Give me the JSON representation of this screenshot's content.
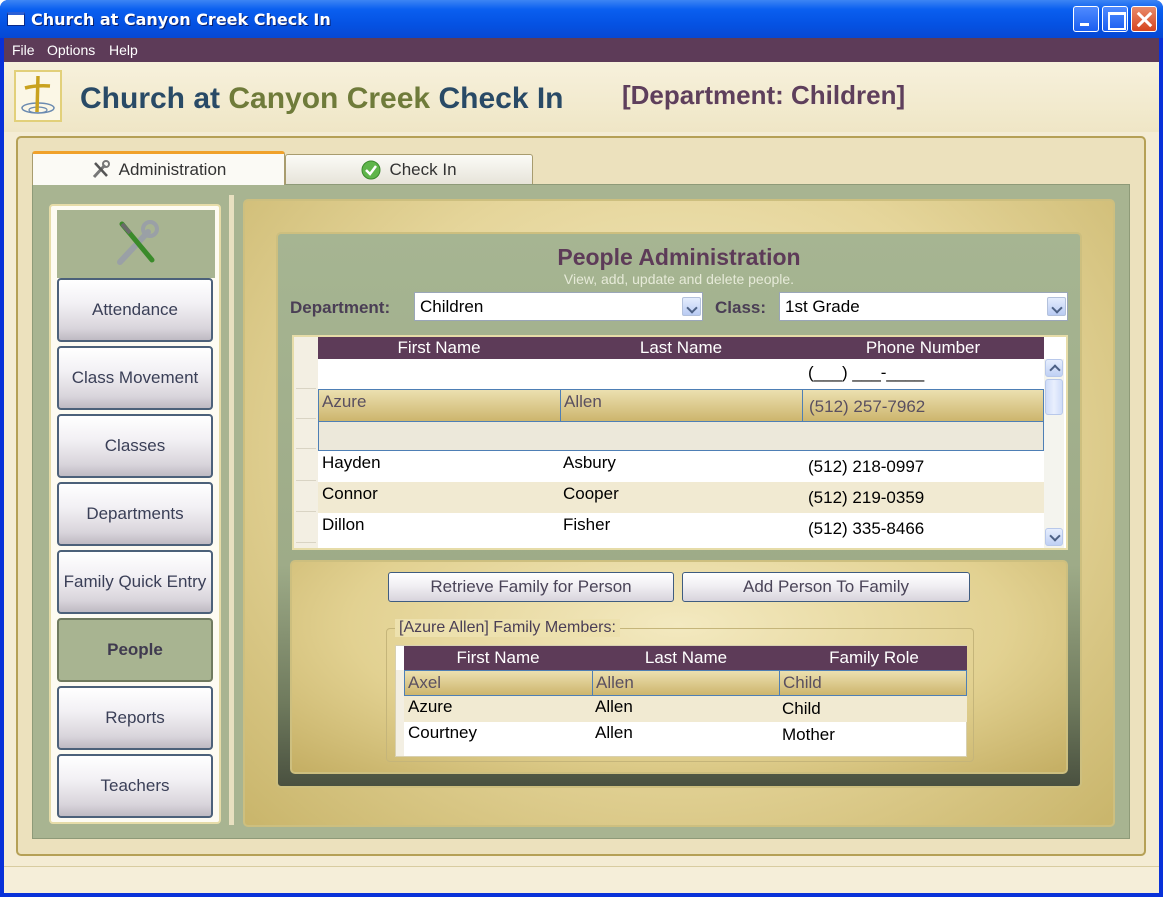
{
  "window": {
    "title": "Church at Canyon Creek Check In"
  },
  "menu": [
    "File",
    "Options",
    "Help"
  ],
  "header": {
    "title_part1": "Church at",
    "title_part2": "Canyon Creek",
    "title_part3": "Check In",
    "department": "[Department: Children]"
  },
  "tabs": [
    {
      "label": "Administration",
      "icon": "tools-icon",
      "active": true
    },
    {
      "label": "Check In",
      "icon": "check-icon",
      "active": false
    }
  ],
  "nav": {
    "items": [
      "Attendance",
      "Class Movement",
      "Classes",
      "Departments",
      "Family Quick Entry",
      "People",
      "Reports",
      "Teachers"
    ],
    "active": "People"
  },
  "people_admin": {
    "title": "People Administration",
    "subtitle": "View, add, update and delete people.",
    "department_label": "Department:",
    "department_value": "Children",
    "class_label": "Class:",
    "class_value": "1st Grade"
  },
  "people_grid": {
    "columns": [
      "First Name",
      "Last Name",
      "Phone Number"
    ],
    "new_row_phone_mask": "(___) ___-____",
    "selected": {
      "first": "Azure",
      "last": "Allen",
      "phone": "(512) 257-7962"
    },
    "rows": [
      {
        "first": "Hayden",
        "last": "Asbury",
        "phone": "(512) 218-0997"
      },
      {
        "first": "Connor",
        "last": "Cooper",
        "phone": "(512) 219-0359"
      },
      {
        "first": "Dillon",
        "last": "Fisher",
        "phone": "(512) 335-8466"
      }
    ]
  },
  "family": {
    "retrieve_button": "Retrieve Family for Person",
    "add_button": "Add Person To Family",
    "group_label": "[Azure Allen] Family Members:",
    "columns": [
      "First Name",
      "Last Name",
      "Family Role"
    ],
    "selected": {
      "first": "Axel",
      "last": "Allen",
      "role": "Child"
    },
    "rows": [
      {
        "first": "Azure",
        "last": "Allen",
        "role": "Child"
      },
      {
        "first": "Courtney",
        "last": "Allen",
        "role": "Mother"
      }
    ]
  },
  "colors": {
    "accent_purple": "#5d3b58",
    "title_blue": "#294a66",
    "title_green": "#6f7b3a",
    "panel_green": "#a8b491",
    "cream": "#f4ecd4"
  }
}
